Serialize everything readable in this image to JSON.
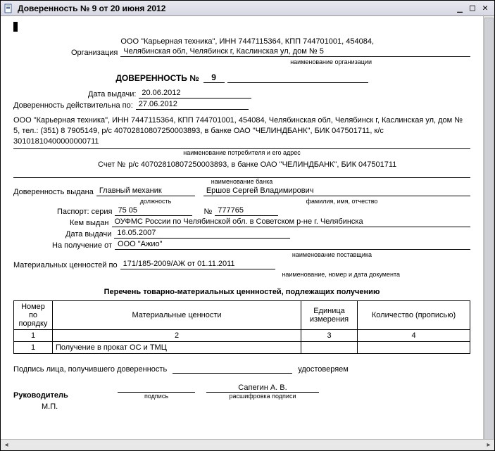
{
  "window": {
    "title": "Доверенность № 9 от 20 июня 2012"
  },
  "org": {
    "label": "Организация",
    "line1": "ООО \"Карьерная техника\", ИНН 7447115364, КПП 744701001, 454084,",
    "line2": "Челябинская обл, Челябинск г, Каслинская ул, дом № 5",
    "sub": "наименование организации"
  },
  "docTitle": {
    "text": "ДОВЕРЕННОСТЬ №",
    "num": "9"
  },
  "dates": {
    "issue_label": "Дата выдачи:",
    "issue": "20.06.2012",
    "valid_label": "Доверенность действительна по:",
    "valid": "27.06.2012"
  },
  "consumer": {
    "text": "ООО \"Карьерная техника\", ИНН 7447115364, КПП 744701001, 454084, Челябинская обл, Челябинск г, Каслинская ул, дом № 5, тел.: (351) 8 7905149, р/с 40702810807250003893, в банке ОАО \"ЧЕЛИНДБАНК\", БИК 047501711, к/с 30101810400000000711",
    "sub": "наименование потребителя и его адрес"
  },
  "account": {
    "label": "Счет №",
    "value": "р/с 40702810807250003893, в банке ОАО \"ЧЕЛИНДБАНК\", БИК 047501711",
    "sub": "наименование банка"
  },
  "issuedTo": {
    "label": "Доверенность выдана",
    "position": "Главный механик",
    "position_sub": "должность",
    "fio": "Ершов Сергей Владимирович",
    "fio_sub": "фамилия, имя, отчество"
  },
  "passport": {
    "series_label": "Паспорт: серия",
    "series": "75 05",
    "num_label": "№",
    "num": "777765",
    "issued_by_label": "Кем выдан",
    "issued_by": "ОУФМС России по Челябинской обл. в Советском р-не г. Челябинска",
    "date_label": "Дата выдачи",
    "date": "16.05.2007"
  },
  "receipt": {
    "label": "На получение от",
    "value": "ООО \"Ажио\"",
    "sub": "наименование поставщика"
  },
  "basis": {
    "label": "Материальных ценностей по",
    "value": "171/185-2009/АЖ от 01.11.2011",
    "sub": "наименование, номер и дата документа"
  },
  "tableTitle": "Перечень товарно-материальных ценнностей, подлежащих получению",
  "columns": {
    "num": "Номер по порядку",
    "goods": "Материальные ценности",
    "unit": "Единица измерения",
    "qty": "Количество (прописью)"
  },
  "colnums": {
    "c1": "1",
    "c2": "2",
    "c3": "3",
    "c4": "4"
  },
  "rows": [
    {
      "n": "1",
      "goods": "Получение в прокат ОС и ТМЦ",
      "unit": "",
      "qty": ""
    }
  ],
  "sig": {
    "line1_left": "Подпись лица, получившего доверенность",
    "line1_right": "удостоверяем",
    "director_label": "Руководитель",
    "sign_sub": "подпись",
    "director_name": "Сапегин А. В.",
    "name_sub": "расшифровка подписи",
    "stamp": "М.П."
  }
}
